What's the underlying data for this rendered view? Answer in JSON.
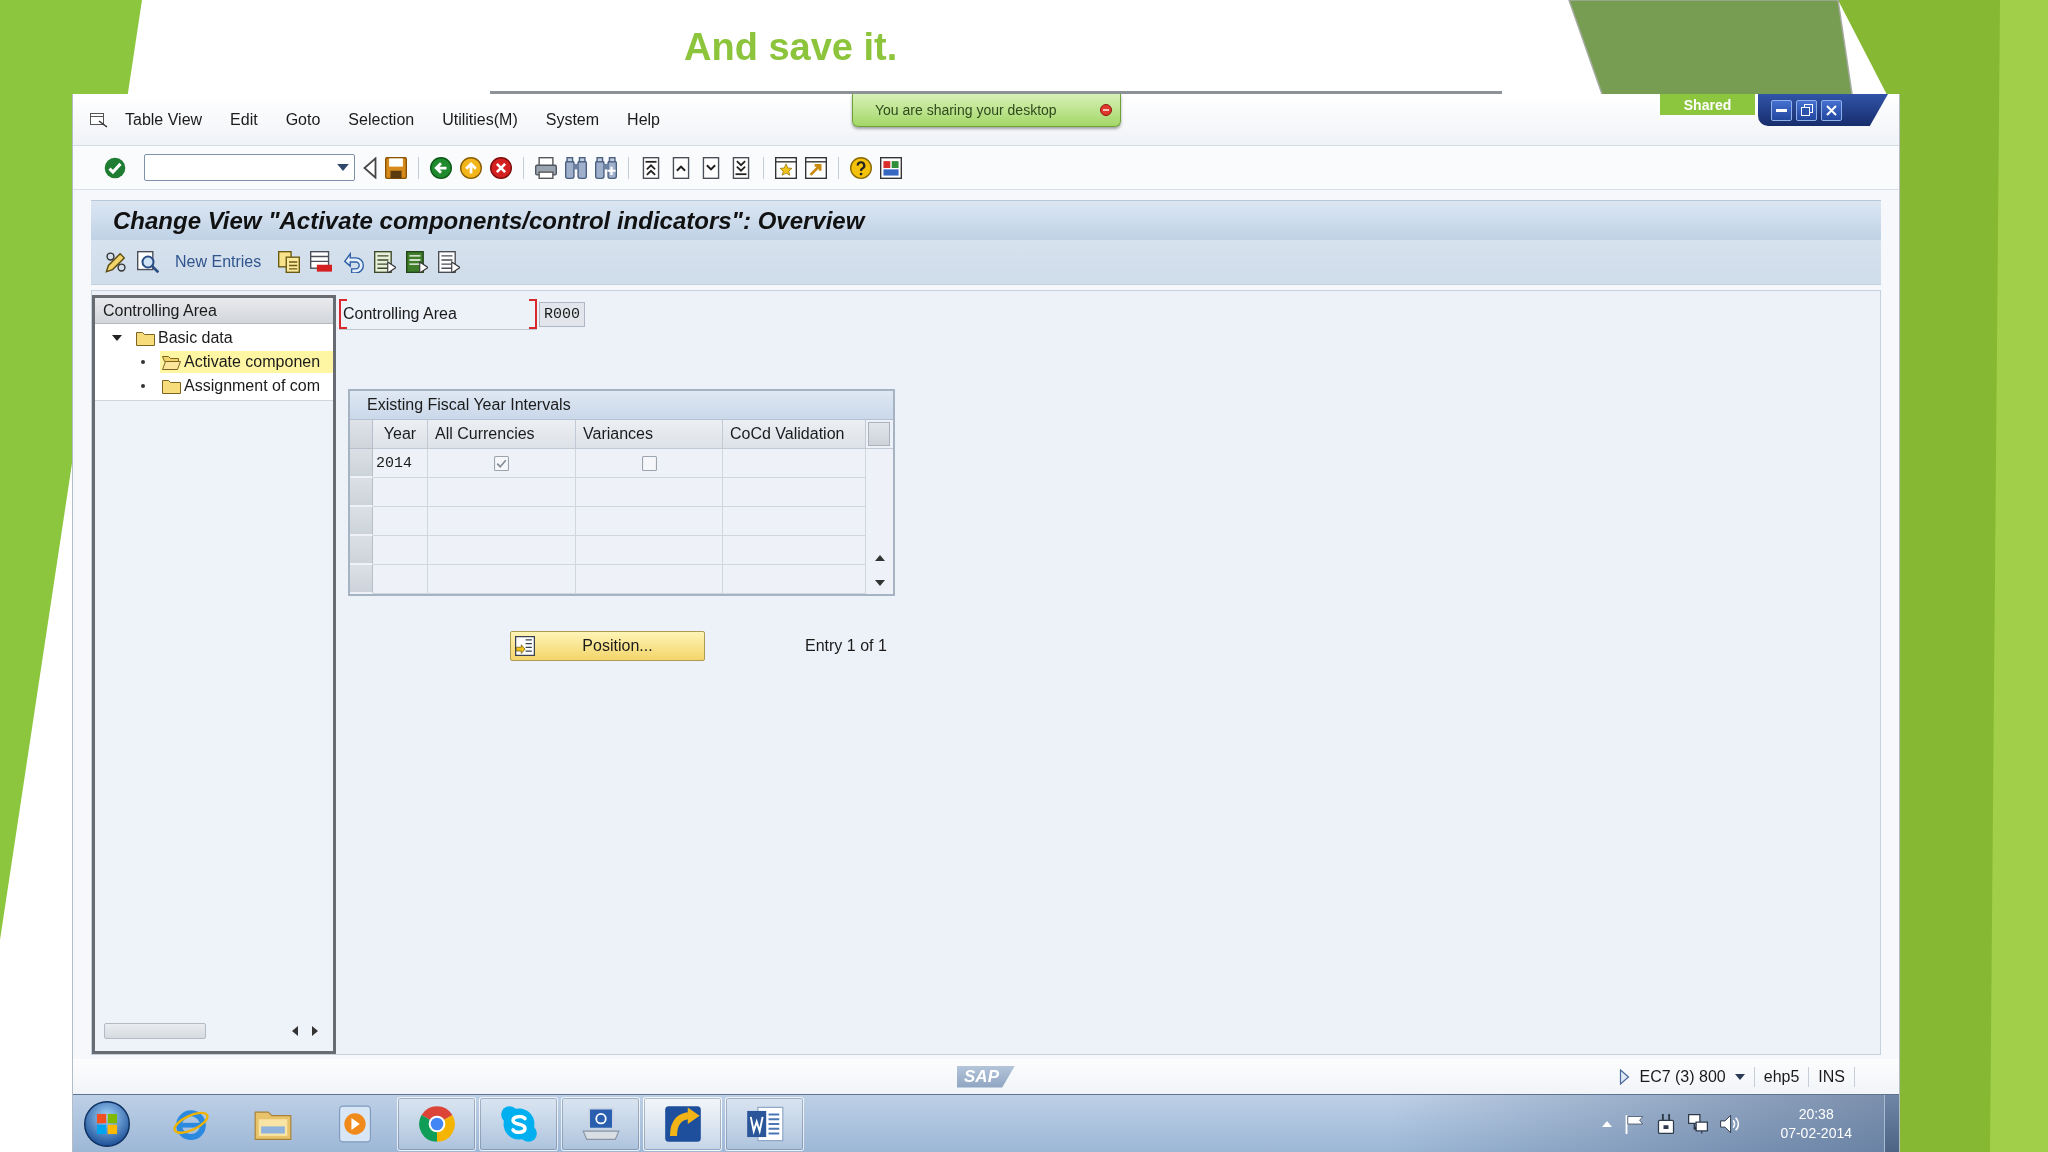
{
  "slide": {
    "heading": "And save it."
  },
  "sharing": {
    "message": "You are sharing your desktop",
    "badge": "Shared"
  },
  "menu_bar": {
    "items": [
      "Table View",
      "Edit",
      "Goto",
      "Selection",
      "Utilities(M)",
      "System",
      "Help"
    ]
  },
  "screen_title": "Change View \"Activate components/control indicators\": Overview",
  "app_toolbar": {
    "new_entries": "New Entries"
  },
  "tree": {
    "header": "Controlling Area",
    "nodes": [
      {
        "label": "Basic data",
        "expanded": true,
        "selected": false,
        "children": [
          {
            "label": "Activate componen",
            "selected": true
          },
          {
            "label": "Assignment of com",
            "selected": false
          }
        ]
      }
    ]
  },
  "controlling_area": {
    "label": "Controlling Area",
    "value": "R000",
    "focused": true
  },
  "fiscal_year_table": {
    "title": "Existing Fiscal Year Intervals",
    "columns": [
      "Year",
      "All Currencies",
      "Variances",
      "CoCd Validation"
    ],
    "rows": [
      {
        "year": "2014",
        "all_currencies": true,
        "variances": false,
        "selected": false
      }
    ]
  },
  "position_button": "Position...",
  "entry_counter": "Entry 1 of 1",
  "status_bar": {
    "logo": "SAP",
    "system": "EC7 (3) 800",
    "server": "ehp5",
    "input_mode": "INS"
  },
  "taskbar": {
    "apps": [
      {
        "running": false,
        "selected": false
      },
      {
        "running": false,
        "selected": false
      },
      {
        "running": false,
        "selected": false
      },
      {
        "running": true,
        "selected": false
      },
      {
        "running": true,
        "selected": false
      },
      {
        "running": true,
        "selected": false
      },
      {
        "running": true,
        "selected": true
      },
      {
        "running": true,
        "selected": false
      }
    ],
    "clock": {
      "time": "20:38",
      "date": "07-02-2014"
    }
  }
}
